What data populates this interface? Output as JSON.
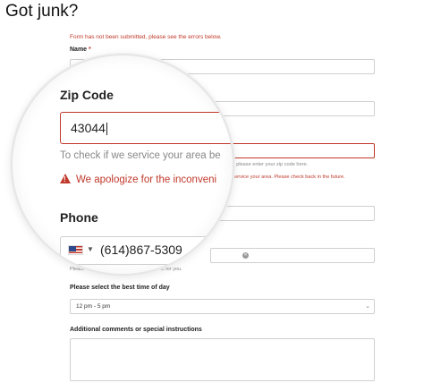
{
  "page": {
    "title": "Got junk?"
  },
  "form": {
    "error_banner": "Form has not been submitted, please see the errors below.",
    "name_label": "Name",
    "name_required_mark": "*",
    "zip_help_partial": "n, please enter your zip code here.",
    "zip_error_partial": "r service your area. Please check back in the future.",
    "phone_help_partial": "Please se",
    "phone_help_partial2": "best for you.",
    "best_time_label": "Please select the best time of day",
    "best_time_value": "12 pm - 5 pm",
    "comments_label": "Additional comments or special instructions"
  },
  "magnifier": {
    "zip_label": "Zip Code",
    "zip_value": "43044",
    "zip_help": "To check if we service your area be",
    "zip_error": "We apologize for the inconveni",
    "phone_label": "Phone",
    "phone_value": "(614)867-5309"
  },
  "colors": {
    "error": "#c0392b",
    "border": "#cfcfcf"
  },
  "icons": {
    "warning": "warning-icon",
    "clear": "clear-icon",
    "dropdown": "chevron-down-icon",
    "flag": "us-flag-icon"
  }
}
